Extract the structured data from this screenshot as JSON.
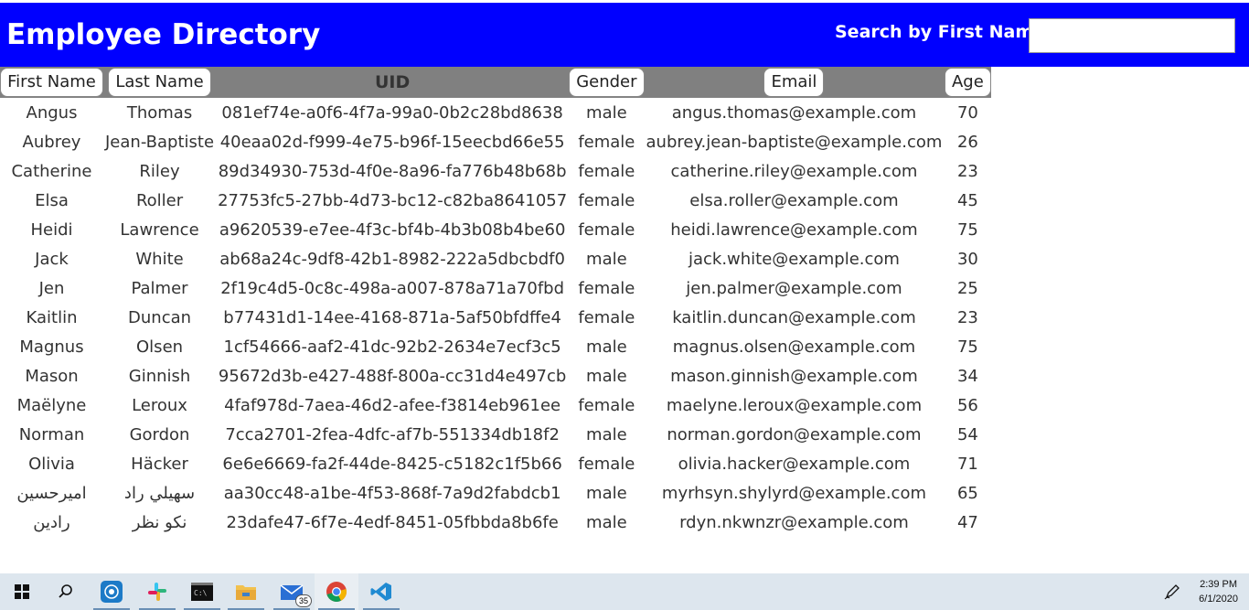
{
  "header": {
    "title": "Employee Directory",
    "search_label": "Search by First Name:",
    "search_value": "",
    "search_placeholder": ""
  },
  "columns": [
    "First Name",
    "Last Name",
    "UID",
    "Gender",
    "Email",
    "Age"
  ],
  "rows": [
    [
      "Angus",
      "Thomas",
      "081ef74e-a0f6-4f7a-99a0-0b2c28bd8638",
      "male",
      "angus.thomas@example.com",
      "70"
    ],
    [
      "Aubrey",
      "Jean-Baptiste",
      "40eaa02d-f999-4e75-b96f-15eecbd66e55",
      "female",
      "aubrey.jean-baptiste@example.com",
      "26"
    ],
    [
      "Catherine",
      "Riley",
      "89d34930-753d-4f0e-8a96-fa776b48b68b",
      "female",
      "catherine.riley@example.com",
      "23"
    ],
    [
      "Elsa",
      "Roller",
      "27753fc5-27bb-4d73-bc12-c82ba8641057",
      "female",
      "elsa.roller@example.com",
      "45"
    ],
    [
      "Heidi",
      "Lawrence",
      "a9620539-e7ee-4f3c-bf4b-4b3b08b4be60",
      "female",
      "heidi.lawrence@example.com",
      "75"
    ],
    [
      "Jack",
      "White",
      "ab68a24c-9df8-42b1-8982-222a5dbcbdf0",
      "male",
      "jack.white@example.com",
      "30"
    ],
    [
      "Jen",
      "Palmer",
      "2f19c4d5-0c8c-498a-a007-878a71a70fbd",
      "female",
      "jen.palmer@example.com",
      "25"
    ],
    [
      "Kaitlin",
      "Duncan",
      "b77431d1-14ee-4168-871a-5af50bfdffe4",
      "female",
      "kaitlin.duncan@example.com",
      "23"
    ],
    [
      "Magnus",
      "Olsen",
      "1cf54666-aaf2-41dc-92b2-2634e7ecf3c5",
      "male",
      "magnus.olsen@example.com",
      "75"
    ],
    [
      "Mason",
      "Ginnish",
      "95672d3b-e427-488f-800a-cc31d4e497cb",
      "male",
      "mason.ginnish@example.com",
      "34"
    ],
    [
      "Maëlyne",
      "Leroux",
      "4faf978d-7aea-46d2-afee-f3814eb961ee",
      "female",
      "maelyne.leroux@example.com",
      "56"
    ],
    [
      "Norman",
      "Gordon",
      "7cca2701-2fea-4dfc-af7b-551334db18f2",
      "male",
      "norman.gordon@example.com",
      "54"
    ],
    [
      "Olivia",
      "Häcker",
      "6e6e6669-fa2f-44de-8425-c5182c1f5b66",
      "female",
      "olivia.hacker@example.com",
      "71"
    ],
    [
      "اميرحسين",
      "سهيلي راد",
      "aa30cc48-a1be-4f53-868f-7a9d2fabdcb1",
      "male",
      "myrhsyn.shylyrd@example.com",
      "65"
    ],
    [
      "رادين",
      "نكو نظر",
      "23dafe47-6f7e-4edf-8451-05fbbda8b6fe",
      "male",
      "rdyn.nkwnzr@example.com",
      "47"
    ]
  ],
  "taskbar": {
    "items": [
      "windows-start-icon",
      "search-icon",
      "app-icon",
      "slack-icon",
      "terminal-icon",
      "file-explorer-icon",
      "mail-icon",
      "chrome-icon",
      "vscode-icon"
    ],
    "mail_badge": "35",
    "time": "2:39 PM",
    "date": "6/1/2020"
  },
  "colors": {
    "header_bg": "#0000ff",
    "table_header_bg": "#808080"
  }
}
